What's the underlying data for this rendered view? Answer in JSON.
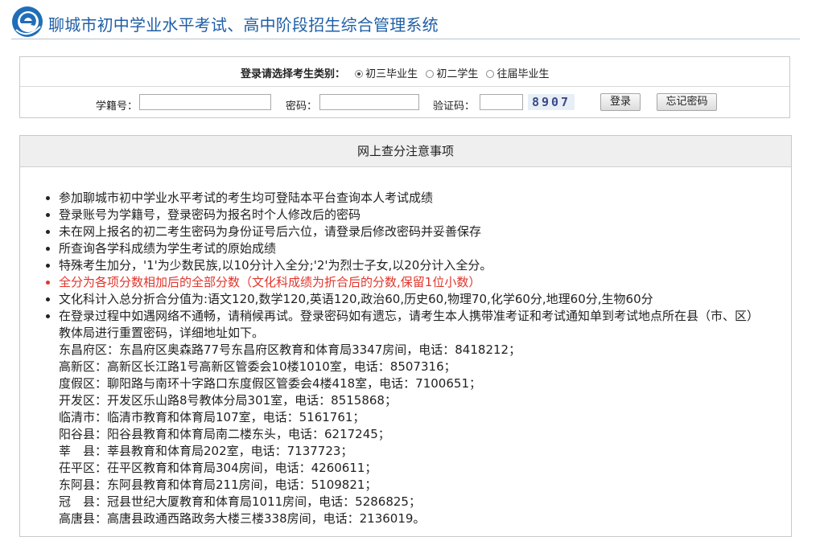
{
  "header": {
    "title": "聊城市初中学业水平考试、高中阶段招生综合管理系统"
  },
  "login": {
    "category_label": "登录请选择考生类别：",
    "categories": [
      {
        "label": "初三毕业生",
        "checked": true
      },
      {
        "label": "初二学生",
        "checked": false
      },
      {
        "label": "往届毕业生",
        "checked": false
      }
    ],
    "student_id_label": "学籍号：",
    "password_label": "密码：",
    "captcha_label": "验证码：",
    "captcha_text": "8907",
    "login_button": "登录",
    "forgot_button": "忘记密码"
  },
  "notice": {
    "title": "网上查分注意事项",
    "items": [
      "参加聊城市初中学业水平考试的考生均可登陆本平台查询本人考试成绩",
      "登录账号为学籍号，登录密码为报名时个人修改后的密码",
      "未在网上报名的初二考生密码为身份证号后六位，请登录后修改密码并妥善保存",
      "所查询各学科成绩为学生考试的原始成绩",
      "特殊考生加分，'1'为少数民族,以10分计入全分;'2'为烈士子女,以20分计入全分。",
      "全分为各项分数相加后的全部分数（文化科成绩为折合后的分数,保留1位小数）",
      "文化科计入总分折合分值为:语文120,数学120,英语120,政治60,历史60,物理70,化学60分,地理60分,生物60分",
      "在登录过程中如遇网络不通畅，请稍候再试。登录密码如有遗忘，请考生本人携带准考证和考试通知单到考试地点所在县（市、区）教体局进行重置密码，详细地址如下。"
    ],
    "offices": [
      "东昌府区：东昌府区奥森路77号东昌府区教育和体育局3347房间，电话：8418212；",
      "高新区：高新区长江路1号高新区管委会10楼1010室，电话：8507316；",
      "度假区：聊阳路与南环十字路口东度假区管委会4楼418室，电话：7100651；",
      "开发区：开发区乐山路8号教体分局301室，电话：8515868；",
      "临清市：临清市教育和体育局107室，电话：5161761；",
      "阳谷县：阳谷县教育和体育局南二楼东头，电话：6217245；",
      "莘　县：莘县教育和体育局202室，电话：7137723；",
      "茌平区：茌平区教育和体育局304房间，电话：4260611；",
      "东阿县：东阿县教育和体育局211房间，电话：5109821；",
      "冠　县：冠县世纪大厦教育和体育局1011房间，电话：5286825；",
      "高唐县：高唐县政通西路政务大楼三楼338房间，电话：2136019。"
    ]
  },
  "colors": {
    "title_blue": "#1f5fa6",
    "highlight_red": "#e0352b"
  }
}
